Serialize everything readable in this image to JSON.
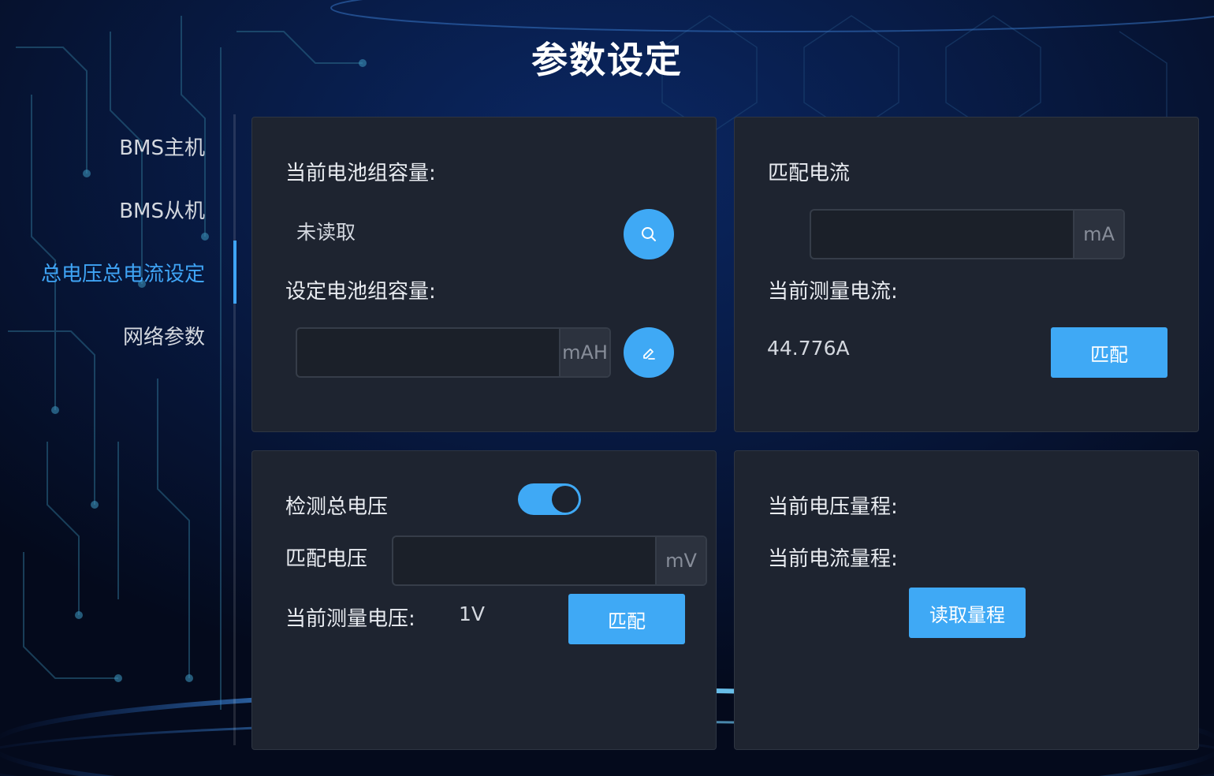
{
  "header": {
    "title": "参数设定"
  },
  "sidebar": {
    "items": [
      {
        "label": "BMS主机",
        "active": false
      },
      {
        "label": "BMS从机",
        "active": false
      },
      {
        "label": "总电压总电流设定",
        "active": true
      },
      {
        "label": "网络参数",
        "active": false
      }
    ]
  },
  "capacity_panel": {
    "current_label": "当前电池组容量:",
    "current_value": "未读取",
    "set_label": "设定电池组容量:",
    "input_value": "",
    "unit": "mAH",
    "read_icon": "search-icon",
    "write_icon": "pencil-icon"
  },
  "current_panel": {
    "title": "匹配电流",
    "input_value": "",
    "unit": "mA",
    "measured_label": "当前测量电流:",
    "measured_value": "44.776A",
    "match_button": "匹配"
  },
  "voltage_panel": {
    "detect_label": "检测总电压",
    "detect_enabled": true,
    "match_label": "匹配电压",
    "input_value": "",
    "unit": "mV",
    "measured_label": "当前测量电压:",
    "measured_value": "1V",
    "match_button": "匹配"
  },
  "range_panel": {
    "voltage_range_label": "当前电压量程:",
    "current_range_label": "当前电流量程:",
    "read_button": "读取量程"
  },
  "colors": {
    "accent": "#3fa9f5",
    "panel_bg": "#1e2430",
    "page_bg": "#040a1c",
    "active_nav": "#3fa4f5"
  }
}
